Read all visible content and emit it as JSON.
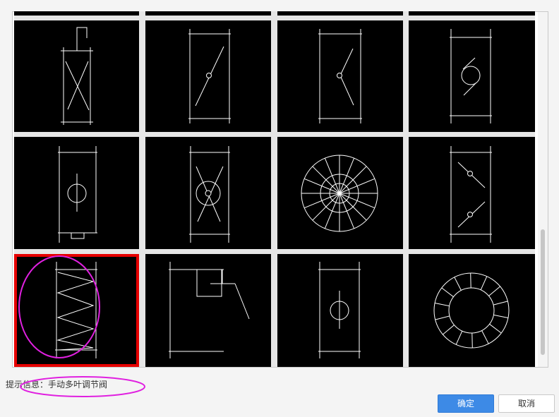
{
  "hint": {
    "label": "提示信息：",
    "value": "手动多叶调节阀"
  },
  "buttons": {
    "confirm": "确定",
    "cancel": "取消"
  },
  "colors": {
    "selected_border": "#e60000",
    "annotation": "#e020e0",
    "primary": "#3d8ae6"
  },
  "symbols": [
    {
      "icon": "damper-top-cut-row",
      "selected": false
    },
    {
      "icon": "damper-top-cut-row",
      "selected": false
    },
    {
      "icon": "damper-top-cut-row",
      "selected": false
    },
    {
      "icon": "damper-top-cut-row",
      "selected": false
    },
    {
      "icon": "damper-actuator-x-icon",
      "selected": false
    },
    {
      "icon": "damper-butterfly-diagonal-icon",
      "selected": false
    },
    {
      "icon": "damper-check-valve-icon",
      "selected": false
    },
    {
      "icon": "damper-circle-rotary-icon",
      "selected": false
    },
    {
      "icon": "damper-circle-pin-icon",
      "selected": false
    },
    {
      "icon": "damper-x-circle-icon",
      "selected": false
    },
    {
      "icon": "radial-blade-fan-icon",
      "selected": false
    },
    {
      "icon": "damper-double-check-icon",
      "selected": false
    },
    {
      "icon": "manual-multi-blade-damper-icon",
      "selected": true
    },
    {
      "icon": "damper-box-lever-icon",
      "selected": false
    },
    {
      "icon": "damper-small-circle-icon",
      "selected": false
    },
    {
      "icon": "ring-blade-fan-icon",
      "selected": false
    }
  ]
}
